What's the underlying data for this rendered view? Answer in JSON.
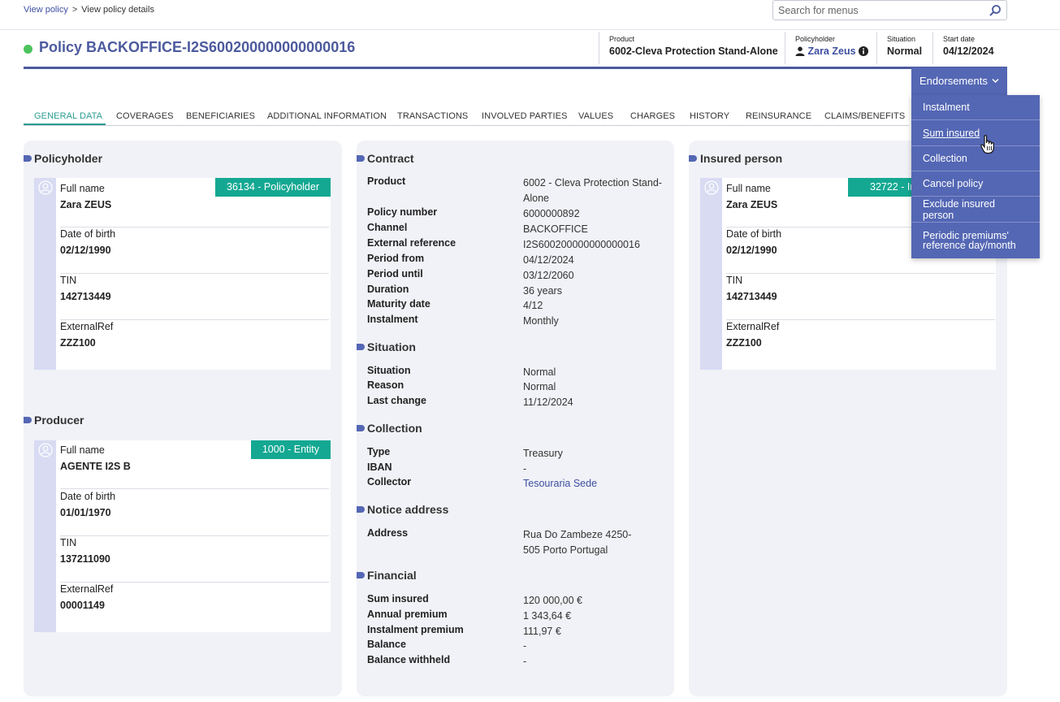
{
  "breadcrumb": {
    "link": "View policy",
    "separator": ">",
    "current": "View policy details"
  },
  "search": {
    "placeholder": "Search for menus",
    "icon": "search-icon"
  },
  "policy": {
    "title": "Policy BACKOFFICE-I2S600200000000000016",
    "status_color": "#4bc35c"
  },
  "header": {
    "product_label": "Product",
    "product_value": "6002-Cleva Protection Stand-Alone",
    "policyholder_label": "Policyholder",
    "policyholder_value": "Zara Zeus",
    "situation_label": "Situation",
    "situation_value": "Normal",
    "start_label": "Start date",
    "start_value": "04/12/2024"
  },
  "endorsements": {
    "label": "Endorsements",
    "items": [
      "Instalment",
      "Sum insured",
      "Collection",
      "Cancel policy",
      "Exclude insured person",
      "Periodic premiums' reference day/month"
    ]
  },
  "tabs": [
    "GENERAL DATA",
    "COVERAGES",
    "BENEFICIARIES",
    "ADDITIONAL INFORMATION",
    "TRANSACTIONS",
    "INVOLVED PARTIES",
    "VALUES",
    "CHARGES",
    "HISTORY",
    "REINSURANCE",
    "CLAIMS/BENEFITS"
  ],
  "policyholder": {
    "title": "Policyholder",
    "badge": "36134 - Policyholder",
    "fields": [
      {
        "label": "Full name",
        "value": "Zara ZEUS"
      },
      {
        "label": "Date of birth",
        "value": "02/12/1990"
      },
      {
        "label": "TIN",
        "value": "142713449"
      },
      {
        "label": "ExternalRef",
        "value": "ZZZ100"
      }
    ]
  },
  "producer": {
    "title": "Producer",
    "badge": "1000 - Entity",
    "fields": [
      {
        "label": "Full name",
        "value": "AGENTE I2S B"
      },
      {
        "label": "Date of birth",
        "value": "01/01/1970"
      },
      {
        "label": "TIN",
        "value": "137211090"
      },
      {
        "label": "ExternalRef",
        "value": "00001149"
      }
    ]
  },
  "insured": {
    "title": "Insured person",
    "badge": "32722 - Insured person",
    "fields": [
      {
        "label": "Full name",
        "value": "Zara ZEUS"
      },
      {
        "label": "Date of birth",
        "value": "02/12/1990"
      },
      {
        "label": "TIN",
        "value": "142713449"
      },
      {
        "label": "ExternalRef",
        "value": "ZZZ100"
      }
    ]
  },
  "contract": {
    "title": "Contract",
    "rows": [
      {
        "label": "Product",
        "value": "6002 - Cleva Protection Stand-Alone"
      },
      {
        "label": "Policy number",
        "value": "6000000892"
      },
      {
        "label": "Channel",
        "value": "BACKOFFICE"
      },
      {
        "label": "External reference",
        "value": "I2S600200000000000016"
      },
      {
        "label": "Period from",
        "value": "04/12/2024"
      },
      {
        "label": "Period until",
        "value": "03/12/2060"
      },
      {
        "label": "Duration",
        "value": "36 years"
      },
      {
        "label": "Maturity date",
        "value": "4/12"
      },
      {
        "label": "Instalment",
        "value": "Monthly"
      }
    ]
  },
  "situation": {
    "title": "Situation",
    "rows": [
      {
        "label": "Situation",
        "value": "Normal"
      },
      {
        "label": "Reason",
        "value": "Normal"
      },
      {
        "label": "Last change",
        "value": "11/12/2024"
      }
    ]
  },
  "collection": {
    "title": "Collection",
    "rows": [
      {
        "label": "Type",
        "value": "Treasury"
      },
      {
        "label": "IBAN",
        "value": "-"
      },
      {
        "label": "Collector",
        "value": "Tesouraria Sede"
      }
    ]
  },
  "notice": {
    "title": "Notice address",
    "rows": [
      {
        "label": "Address",
        "value": "Rua Do Zambeze 4250-505 Porto Portugal"
      }
    ]
  },
  "financial": {
    "title": "Financial",
    "rows": [
      {
        "label": "Sum insured",
        "value": "120 000,00 €"
      },
      {
        "label": "Annual premium",
        "value": "1 343,64 €"
      },
      {
        "label": "Instalment premium",
        "value": "111,97 €"
      },
      {
        "label": "Balance",
        "value": "-"
      },
      {
        "label": "Balance withheld",
        "value": "-"
      }
    ]
  }
}
